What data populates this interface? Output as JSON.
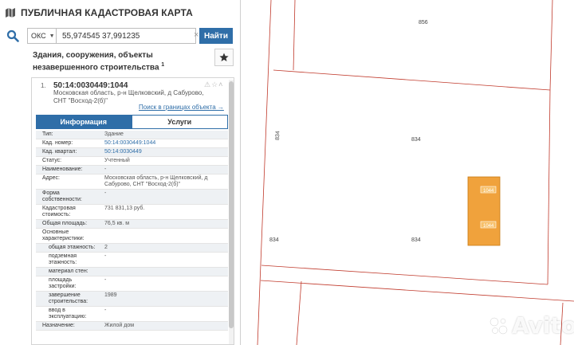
{
  "app": {
    "title": "ПУБЛИЧНАЯ КАДАСТРОВАЯ КАРТА"
  },
  "search": {
    "type_value": "ОКС",
    "query": "55,974545 37,991235",
    "clear_symbol": "×",
    "button_label": "Найти"
  },
  "section": {
    "title": "Здания, сооружения, объекты незавершенного строительства",
    "count": "1"
  },
  "object": {
    "index": "1.",
    "cadastral_number": "50:14:0030449:1044",
    "address_short": "Московская область, р-н Щелковский, д Сабурово, СНТ \"Восход-2(б)\"",
    "search_link": "Поиск в границах объекта →"
  },
  "tabs": [
    {
      "label": "Информация",
      "active": true
    },
    {
      "label": "Услуги",
      "active": false
    }
  ],
  "info_rows": [
    {
      "key": "Тип:",
      "value": "Здание"
    },
    {
      "key": "Кад. номер:",
      "value": "50:14:0030449:1044",
      "link": true
    },
    {
      "key": "Кад. квартал:",
      "value": "50:14:0030449",
      "link": true
    },
    {
      "key": "Статус:",
      "value": "Учтенный"
    },
    {
      "key": "Наименование:",
      "value": "-"
    },
    {
      "key": "Адрес:",
      "value": "Московская область, р-н Щелковский, д Сабурово, СНТ \"Восход-2(б)\""
    },
    {
      "key": "Форма собственности:",
      "value": "-"
    },
    {
      "key": "Кадастровая стоимость:",
      "value": "731 831,13 руб."
    },
    {
      "key": "Общая площадь:",
      "value": "76,5 кв. м"
    },
    {
      "key": "Основные характеристики:",
      "value": ""
    },
    {
      "key": "общая этажность:",
      "value": "2",
      "sub": true
    },
    {
      "key": "подземная этажность:",
      "value": "-",
      "sub": true
    },
    {
      "key": "материал стен:",
      "value": "",
      "sub": true
    },
    {
      "key": "площадь застройки:",
      "value": "-",
      "sub": true
    },
    {
      "key": "завершение строительства:",
      "value": "1989",
      "sub": true
    },
    {
      "key": "ввод в эксплуатацию:",
      "value": "-",
      "sub": true
    },
    {
      "key": "Назначение:",
      "value": "Жилой дом"
    }
  ],
  "map": {
    "parcel_labels": [
      "856",
      "834",
      "834",
      "834",
      "834"
    ],
    "building_labels": [
      "1044",
      "1044"
    ],
    "colors": {
      "parcel_line": "#c0392b",
      "building_fill": "#f0a23c",
      "building_stroke": "#c97a14"
    }
  },
  "watermark": {
    "text": "Avito"
  },
  "colors": {
    "accent": "#2f6ea8"
  }
}
